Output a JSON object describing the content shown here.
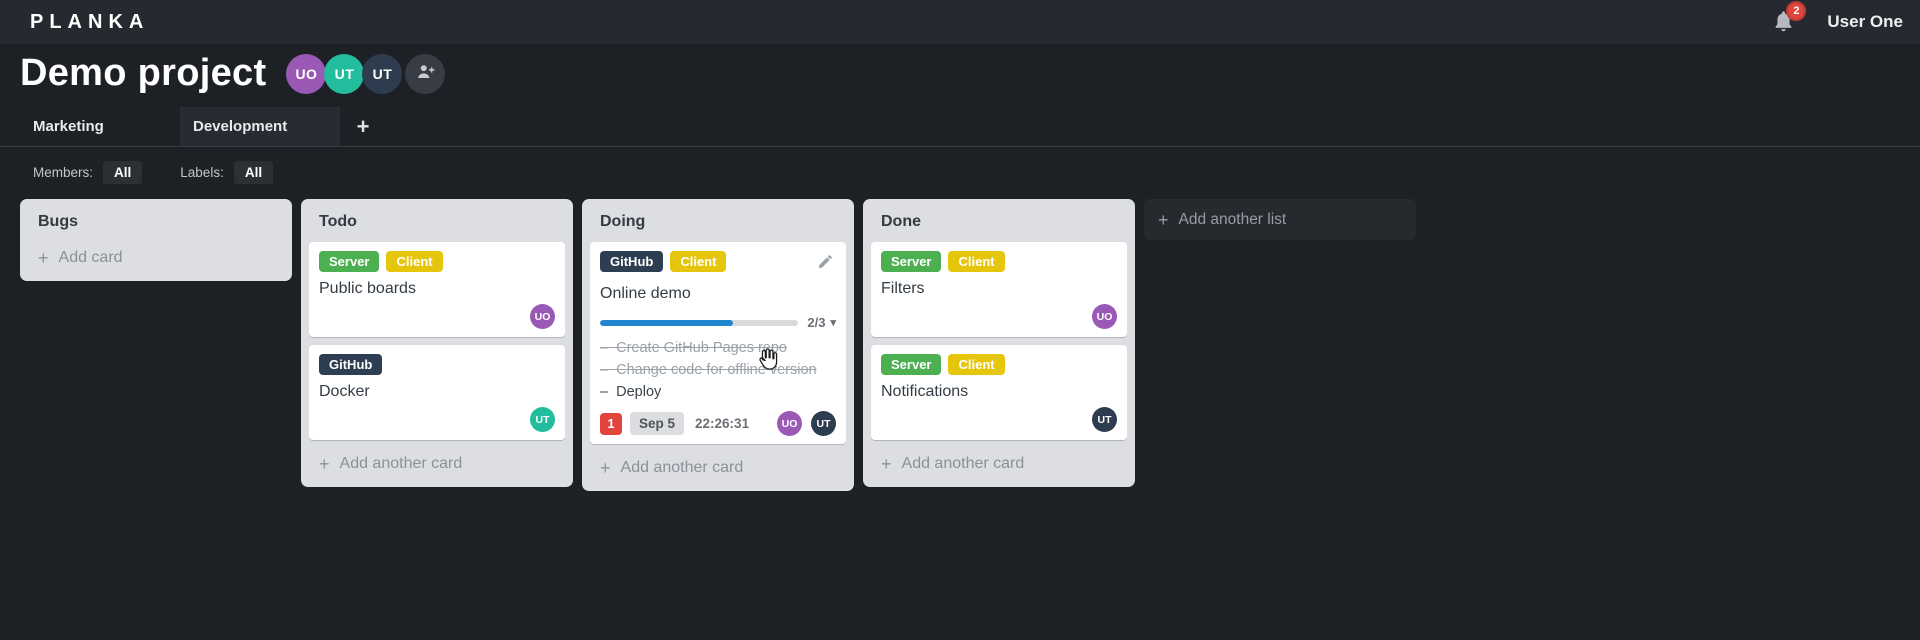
{
  "topbar": {
    "logo": "PLANKA",
    "notifications_count": "2",
    "user_name": "User One"
  },
  "project": {
    "title": "Demo project",
    "members": [
      {
        "initials": "UO",
        "color": "#9b59b6"
      },
      {
        "initials": "UT",
        "color": "#22bd9c"
      },
      {
        "initials": "UT",
        "color": "#2d3c4f"
      }
    ]
  },
  "tabs": {
    "items": [
      {
        "label": "Marketing",
        "active": false
      },
      {
        "label": "Development",
        "active": true
      }
    ],
    "add_label": "+"
  },
  "filters": {
    "members_label": "Members:",
    "members_value": "All",
    "labels_label": "Labels:",
    "labels_value": "All"
  },
  "board": {
    "add_list_label": "Add another list",
    "lists": [
      {
        "title": "Bugs",
        "add_card_label": "Add card",
        "cards": []
      },
      {
        "title": "Todo",
        "add_card_label": "Add another card",
        "cards": [
          {
            "title": "Public boards",
            "labels": [
              {
                "text": "Server",
                "color": "#4caf50"
              },
              {
                "text": "Client",
                "color": "#e6c60d"
              }
            ],
            "members": [
              {
                "initials": "UO",
                "color": "#9b59b6"
              }
            ]
          },
          {
            "title": "Docker",
            "labels": [
              {
                "text": "GitHub",
                "color": "#2e3e52"
              }
            ],
            "members": [
              {
                "initials": "UT",
                "color": "#22bd9c"
              }
            ]
          }
        ]
      },
      {
        "title": "Doing",
        "add_card_label": "Add another card",
        "cards": [
          {
            "title": "Online demo",
            "labels": [
              {
                "text": "GitHub",
                "color": "#2e3e52"
              },
              {
                "text": "Client",
                "color": "#e6c60d"
              }
            ],
            "progress": {
              "label": "2/3",
              "percent": 67
            },
            "tasks": [
              {
                "text": "Create GitHub Pages repo",
                "done": true
              },
              {
                "text": "Change code for offline version",
                "done": true
              },
              {
                "text": "Deploy",
                "done": false
              }
            ],
            "notifications_count": "1",
            "due_date": "Sep 5",
            "timer": "22:26:31",
            "members": [
              {
                "initials": "UO",
                "color": "#9b59b6"
              },
              {
                "initials": "UT",
                "color": "#2d3c4f"
              }
            ]
          }
        ]
      },
      {
        "title": "Done",
        "add_card_label": "Add another card",
        "cards": [
          {
            "title": "Filters",
            "labels": [
              {
                "text": "Server",
                "color": "#4caf50"
              },
              {
                "text": "Client",
                "color": "#e6c60d"
              }
            ],
            "members": [
              {
                "initials": "UO",
                "color": "#9b59b6"
              }
            ]
          },
          {
            "title": "Notifications",
            "labels": [
              {
                "text": "Server",
                "color": "#4caf50"
              },
              {
                "text": "Client",
                "color": "#e6c60d"
              }
            ],
            "members": [
              {
                "initials": "UT",
                "color": "#2d3c4f"
              }
            ]
          }
        ]
      }
    ]
  },
  "icons": {
    "plus": "+",
    "caret_down": "▾"
  },
  "colors": {
    "progress_bar": "#2185d0",
    "notification_badge": "#e0443a"
  }
}
